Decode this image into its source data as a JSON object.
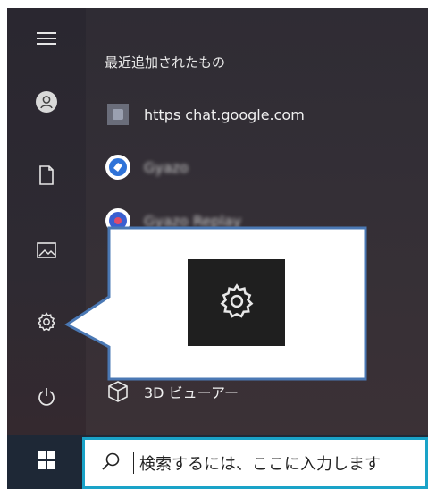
{
  "start_menu": {
    "rail": {
      "items": [
        {
          "name": "menu",
          "icon": "hamburger-icon"
        },
        {
          "name": "account",
          "icon": "user-icon"
        },
        {
          "name": "documents",
          "icon": "document-icon"
        },
        {
          "name": "pictures",
          "icon": "picture-icon"
        },
        {
          "name": "settings",
          "icon": "gear-icon"
        },
        {
          "name": "power",
          "icon": "power-icon"
        }
      ]
    },
    "list": {
      "header": "最近追加されたもの",
      "items": [
        {
          "label": "https  chat.google.com",
          "icon": "web-app-icon"
        },
        {
          "label": "Gyazo",
          "icon": "gyazo-icon",
          "blurred": true
        },
        {
          "label": "Gyazo Replay",
          "icon": "gyazo-replay-icon",
          "blurred": true
        },
        {
          "label": "3D ビューアー",
          "icon": "3d-viewer-icon"
        }
      ]
    }
  },
  "callout": {
    "icon": "gear-icon",
    "border_color": "#4a78b4"
  },
  "taskbar": {
    "start_icon": "windows-logo-icon",
    "search": {
      "icon": "search-icon",
      "placeholder": "検索するには、ここに入力します"
    },
    "accent": "#1aa3c8"
  }
}
